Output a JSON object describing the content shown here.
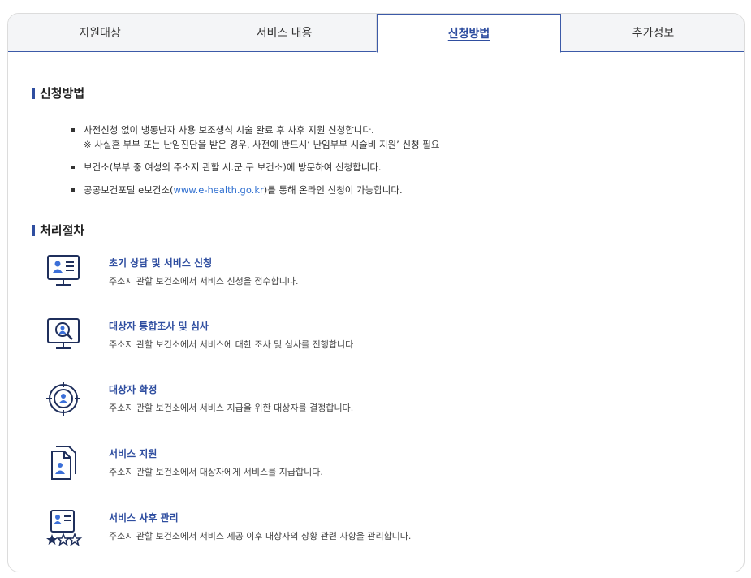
{
  "tabs": [
    {
      "label": "지원대상"
    },
    {
      "label": "서비스 내용"
    },
    {
      "label": "신청방법"
    },
    {
      "label": "추가정보"
    }
  ],
  "application": {
    "title": "신청방법",
    "items": [
      {
        "text": "사전신청 없이 냉동난자 사용 보조생식 시술 완료 후 사후 지원 신청합니다.",
        "note": "※ 사실혼 부부 또는 난임진단을 받은 경우, 사전에 반드시‘ 난임부부 시술비 지원’ 신청 필요"
      },
      {
        "text": "보건소(부부 중 여성의 주소지 관할 시.군.구 보건소)에 방문하여 신청합니다."
      },
      {
        "text_before": "공공보건포털 e보건소(",
        "link": "www.e-health.go.kr",
        "text_after": ")를 통해 온라인 신청이 가능합니다."
      }
    ]
  },
  "process": {
    "title": "처리절차",
    "steps": [
      {
        "title": "초기 상담 및 서비스 신청",
        "desc": "주소지 관할 보건소에서 서비스 신청을 접수합니다.",
        "icon": "monitor-profile-icon"
      },
      {
        "title": "대상자 통합조사 및 심사",
        "desc": "주소지 관할 보건소에서 서비스에 대한 조사 및 심사를 진행합니다",
        "icon": "monitor-search-icon"
      },
      {
        "title": "대상자 확정",
        "desc": "주소지 관할 보건소에서 서비스 지급을 위한 대상자를 결정합니다.",
        "icon": "target-person-icon"
      },
      {
        "title": "서비스 지원",
        "desc": "주소지 관할 보건소에서 대상자에게 서비스를 지급합니다.",
        "icon": "document-person-icon"
      },
      {
        "title": "서비스 사후 관리",
        "desc": "주소지 관할 보건소에서 서비스 제공 이후 대상자의 상황 관련 사항을 관리합니다.",
        "icon": "rating-profile-icon"
      }
    ]
  },
  "colors": {
    "accent": "#2f4ea0",
    "link": "#2f6fd0",
    "tab_bg": "#f4f5f7"
  }
}
